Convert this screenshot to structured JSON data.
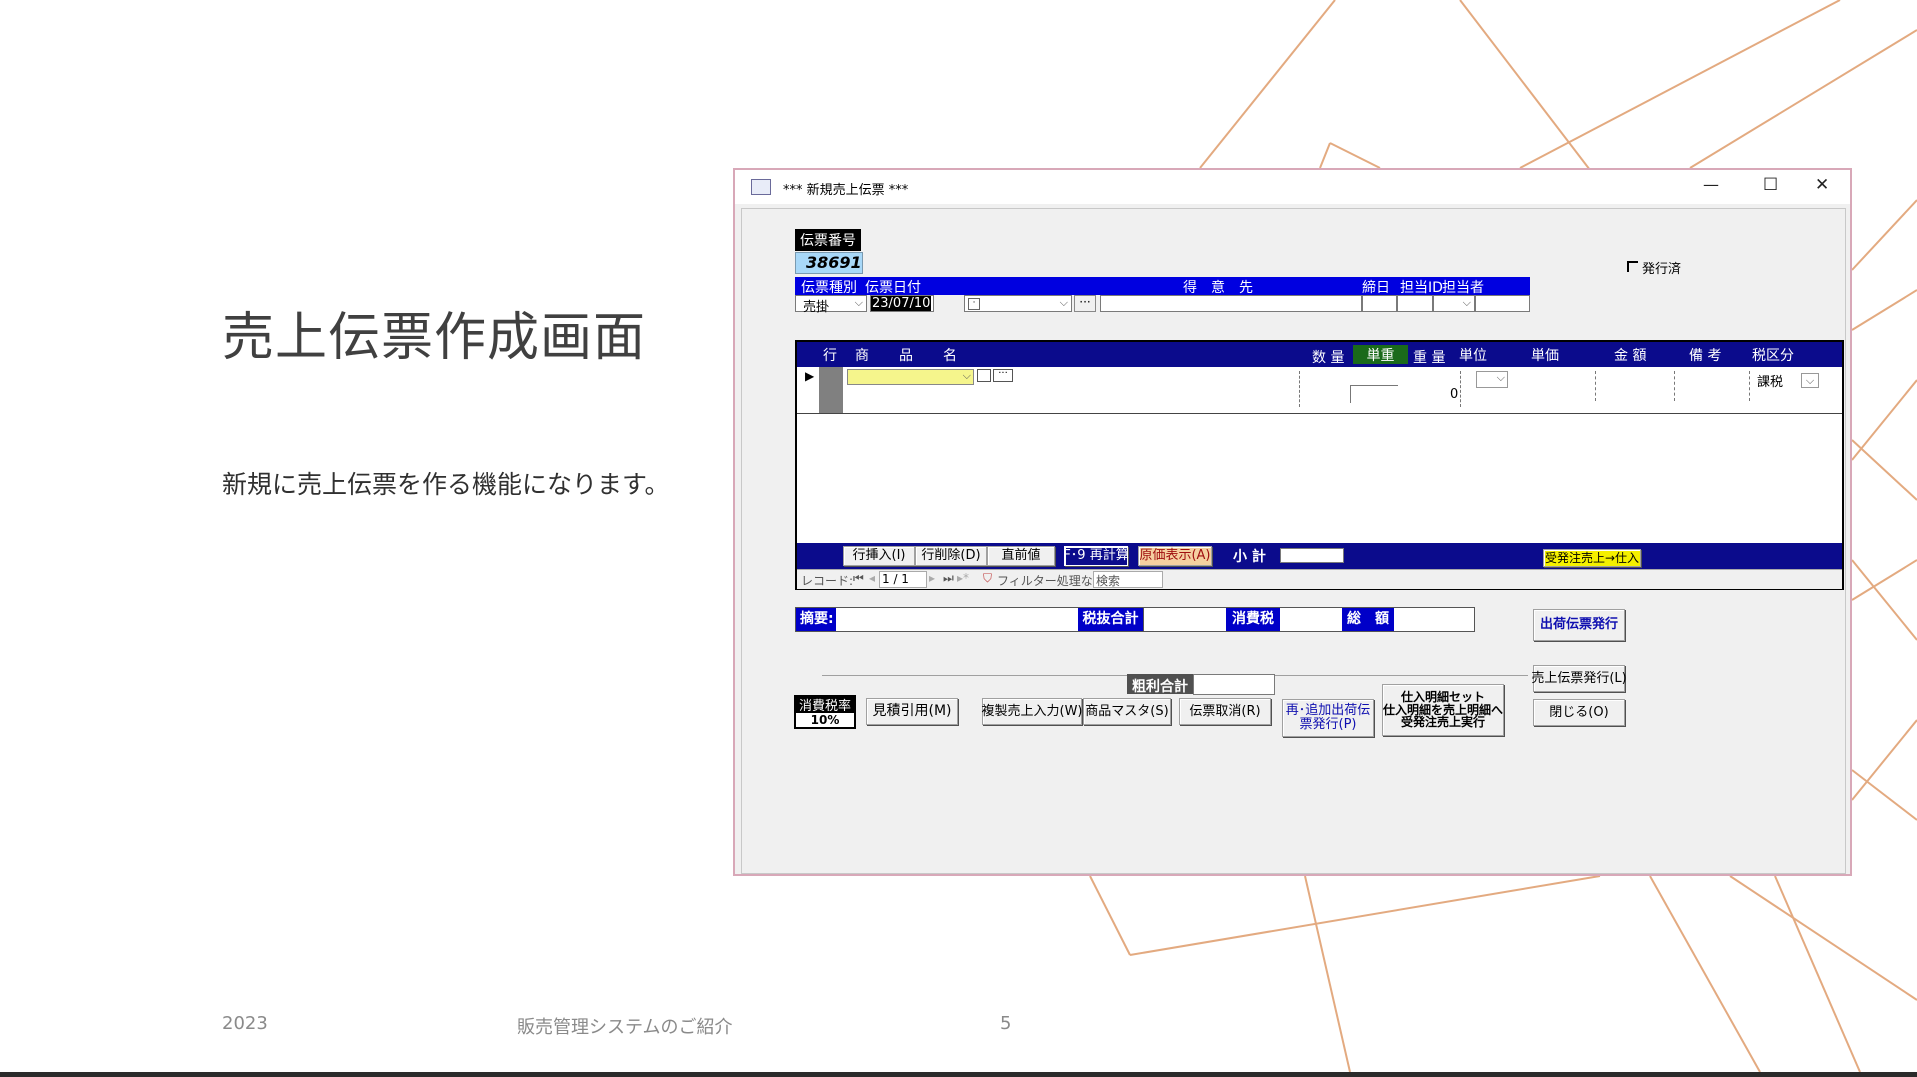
{
  "slide": {
    "title": "売上伝票作成画面",
    "body": "新規に売上伝票を作る機能になります。",
    "footer_year": "2023",
    "footer_center": "販売管理システムのご紹介",
    "page_number": "5"
  },
  "window": {
    "title": "*** 新規売上伝票 ***",
    "minimize": "—",
    "maximize": "☐",
    "close": "✕"
  },
  "form": {
    "voucher_no_label": "伝票番号",
    "voucher_no": "38691",
    "issued_checkbox_label": "発行済",
    "header_cols": {
      "type": "伝票種別",
      "date": "伝票日付",
      "customer": "得　意　先",
      "closing": "締日",
      "staff_id": "担当ID",
      "staff": "担当者"
    },
    "voucher_type_value": "売掛",
    "voucher_date_value": "23/07/10",
    "detail_cols": {
      "row": "行",
      "product": "商　品　名",
      "qty": "数 量",
      "unit_weight": "単重",
      "weight": "重 量",
      "unit": "単位",
      "price": "単価",
      "amount": "金 額",
      "note": "備 考",
      "tax_class": "税区分"
    },
    "detail_row": {
      "weight_value": "0",
      "tax_class_value": "課税"
    },
    "grid_buttons": {
      "insert_row": "行挿入(I)",
      "delete_row": "行削除(D)",
      "previous_value": "直前値",
      "recalc": "F･9 再計算",
      "cost_display": "原価表示(A)",
      "subtotal_label": "小 計",
      "order_to_sales": "受発注売上→仕入"
    },
    "record_nav": {
      "label": "レコード:",
      "position": "1 / 1",
      "filter": "フィルター処理なし",
      "search": "検索"
    },
    "totals": {
      "memo_label": "摘要:",
      "pretax_label": "税抜合計",
      "tax_label": "消費税",
      "total_label": "総　額",
      "gross_profit_label": "粗利合計"
    },
    "tax_rate_label": "消費税率",
    "tax_rate_value": "10%",
    "buttons": {
      "shipping_slip": "出荷伝票発行",
      "sales_slip": "売上伝票発行(L)",
      "close": "閉じる(O)",
      "quote_ref": "見積引用(M)",
      "duplicate_sales": "複製売上入力(W)",
      "product_master": "商品マスタ(S)",
      "cancel_slip": "伝票取消(R)",
      "reissue_line1": "再･追加出荷伝",
      "reissue_line2": "票発行(P)",
      "purchase_line1": "仕入明細セット",
      "purchase_line2": "仕入明細を売上明細へ",
      "purchase_line3": "受発注売上実行"
    }
  },
  "colors": {
    "header_blue": "#0000e0",
    "grid_navy": "#0b0b8c",
    "highlight_yellow": "#f5f58c",
    "accent_line": "#e0a070"
  }
}
